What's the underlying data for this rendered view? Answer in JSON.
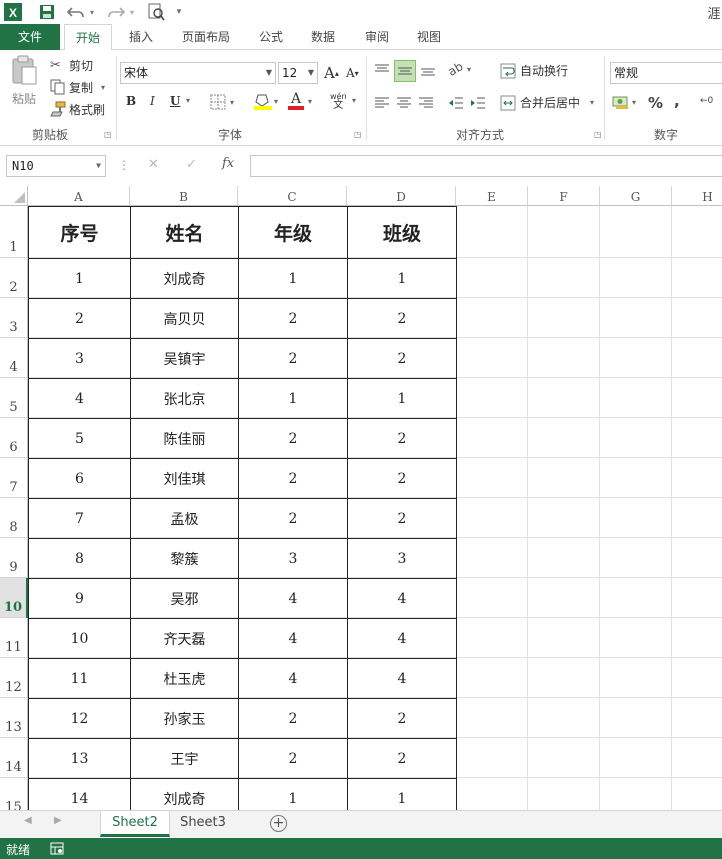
{
  "app": {
    "logo_letter": "X",
    "title_fragment": "涯",
    "qat_extra": "▾"
  },
  "ribbon_tabs": [
    "文件",
    "开始",
    "插入",
    "页面布局",
    "公式",
    "数据",
    "审阅",
    "视图"
  ],
  "clipboard": {
    "paste_label": "粘贴",
    "cut_label": "剪切",
    "copy_label": "复制",
    "format_painter_label": "格式刷",
    "group_label": "剪贴板"
  },
  "font": {
    "name": "宋体",
    "size": "12",
    "grow": "A",
    "shrink": "A",
    "bold": "B",
    "italic": "I",
    "underline": "U",
    "font_color_letter": "A",
    "phonetic": "wén",
    "group_label": "字体"
  },
  "alignment": {
    "wrap_text_label": "自动换行",
    "merge_center_label": "合并后居中",
    "group_label": "对齐方式"
  },
  "number": {
    "format": "常规",
    "percent": "%",
    "comma": ",",
    "decimal": "←0",
    "group_label": "数字"
  },
  "formula_bar": {
    "name_box": "N10",
    "fx": "fx",
    "cancel": "✕",
    "enter": "✓",
    "dots": "⋮",
    "value": ""
  },
  "columns": [
    "A",
    "B",
    "C",
    "D",
    "E",
    "F",
    "G",
    "H"
  ],
  "row_numbers": [
    "1",
    "2",
    "3",
    "4",
    "5",
    "6",
    "7",
    "8",
    "9",
    "10",
    "11",
    "12",
    "13",
    "14",
    "15"
  ],
  "selected_row": "10",
  "table": {
    "headers": [
      "序号",
      "姓名",
      "年级",
      "班级"
    ],
    "rows": [
      [
        "1",
        "刘成奇",
        "1",
        "1"
      ],
      [
        "2",
        "高贝贝",
        "2",
        "2"
      ],
      [
        "3",
        "吴镇宇",
        "2",
        "2"
      ],
      [
        "4",
        "张北京",
        "1",
        "1"
      ],
      [
        "5",
        "陈佳丽",
        "2",
        "2"
      ],
      [
        "6",
        "刘佳琪",
        "2",
        "2"
      ],
      [
        "7",
        "孟极",
        "2",
        "2"
      ],
      [
        "8",
        "黎簇",
        "3",
        "3"
      ],
      [
        "9",
        "吴邪",
        "4",
        "4"
      ],
      [
        "10",
        "齐天磊",
        "4",
        "4"
      ],
      [
        "11",
        "杜玉虎",
        "4",
        "4"
      ],
      [
        "12",
        "孙家玉",
        "2",
        "2"
      ],
      [
        "13",
        "王宇",
        "2",
        "2"
      ],
      [
        "14",
        "刘成奇",
        "1",
        "1"
      ]
    ]
  },
  "sheets": [
    "Sheet2",
    "Sheet3"
  ],
  "add_sheet": "+",
  "status": {
    "ready": "就绪"
  },
  "colors": {
    "accent": "#217346",
    "selection_fill": "#a9d08e"
  }
}
